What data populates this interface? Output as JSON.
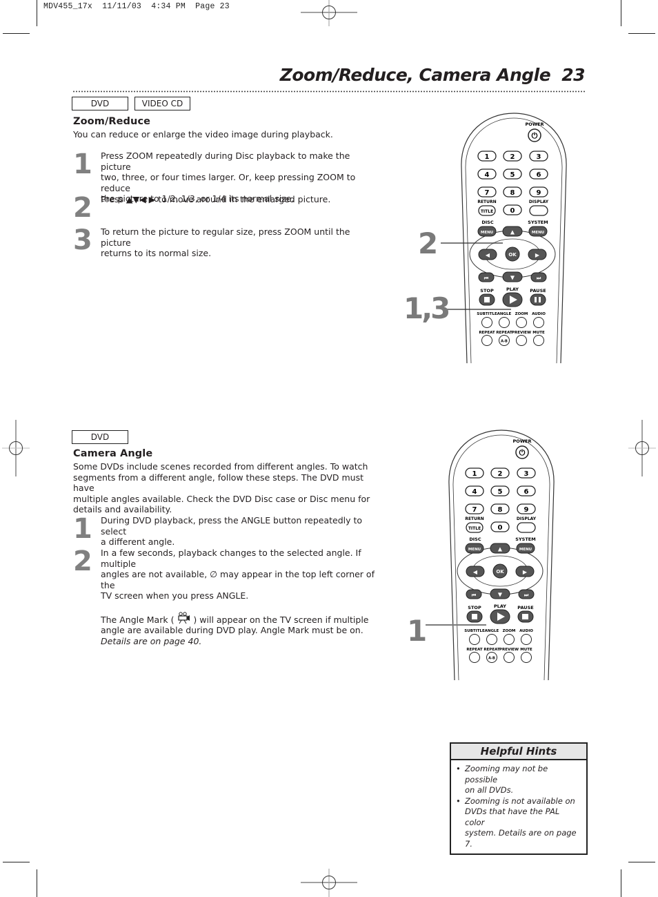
{
  "slug": "MDV455_17x  11/11/03  4:34 PM  Page 23",
  "header": {
    "title": "Zoom/Reduce, Camera Angle",
    "page_number": "23"
  },
  "zoom_reduce": {
    "tags": [
      "DVD",
      "VIDEO CD"
    ],
    "title": "Zoom/Reduce",
    "intro": "You can reduce or enlarge the video image during playback.",
    "steps": [
      {
        "num": "1",
        "lines": [
          "Press ZOOM repeatedly during Disc playback to make the picture",
          "two, three, or four times larger. Or, keep pressing ZOOM to reduce",
          "the picture to 1/2, 1/3, or 1/4 its normal size."
        ]
      },
      {
        "num": "2",
        "lines": [
          "Press ▲▼◀ ▶ to move around in the enlarged picture."
        ]
      },
      {
        "num": "3",
        "lines": [
          "To return the picture to regular size, press ZOOM until the picture",
          "returns to its normal size."
        ]
      }
    ],
    "callouts": [
      "2",
      "1,3"
    ]
  },
  "camera_angle": {
    "tags": [
      "DVD"
    ],
    "title": "Camera Angle",
    "intro_lines": [
      "Some DVDs include scenes recorded from different angles. To watch",
      "segments from a different angle, follow these steps. The DVD must have",
      "multiple angles available. Check the DVD Disc case or Disc menu for",
      "details and availability."
    ],
    "steps": [
      {
        "num": "1",
        "lines": [
          "During DVD playback, press the ANGLE button repeatedly to select",
          "a different angle."
        ]
      },
      {
        "num": "2",
        "lines": [
          "In a few seconds, playback changes to the selected angle. If multiple",
          "angles are not available, ∅ may appear in the top left corner of the",
          "TV screen when you press ANGLE."
        ]
      }
    ],
    "angle_mark_pre": "The Angle Mark (",
    "angle_mark_post": ") will appear on the TV screen if multiple",
    "angle_mark_line2": "angle are available during DVD play. Angle Mark must be on.",
    "angle_mark_ref": "Details are on page 40.",
    "callouts": [
      "1"
    ]
  },
  "remote": {
    "power": "POWER",
    "digits": [
      "1",
      "2",
      "3",
      "4",
      "5",
      "6",
      "7",
      "8",
      "9",
      "0"
    ],
    "return": "RETURN",
    "title_btn": "TITLE",
    "display": "DISPLAY",
    "disc": "DISC",
    "system": "SYSTEM",
    "menu": "MENU",
    "ok": "OK",
    "stop": "STOP",
    "play": "PLAY",
    "pause": "PAUSE",
    "subtitle": "SUBTITLE",
    "angle": "ANGLE",
    "zoom": "ZOOM",
    "audio": "AUDIO",
    "repeat": "REPEAT",
    "repeat_ab": "REPEAT",
    "ab": "A-B",
    "preview": "PREVIEW",
    "mute": "MUTE"
  },
  "helpful_hints": {
    "title": "Helpful Hints",
    "items": [
      [
        "Zooming may not be possible",
        "on all DVDs."
      ],
      [
        "Zooming is not available on",
        "DVDs that have the PAL color",
        "system. Details are on page 7."
      ]
    ]
  }
}
